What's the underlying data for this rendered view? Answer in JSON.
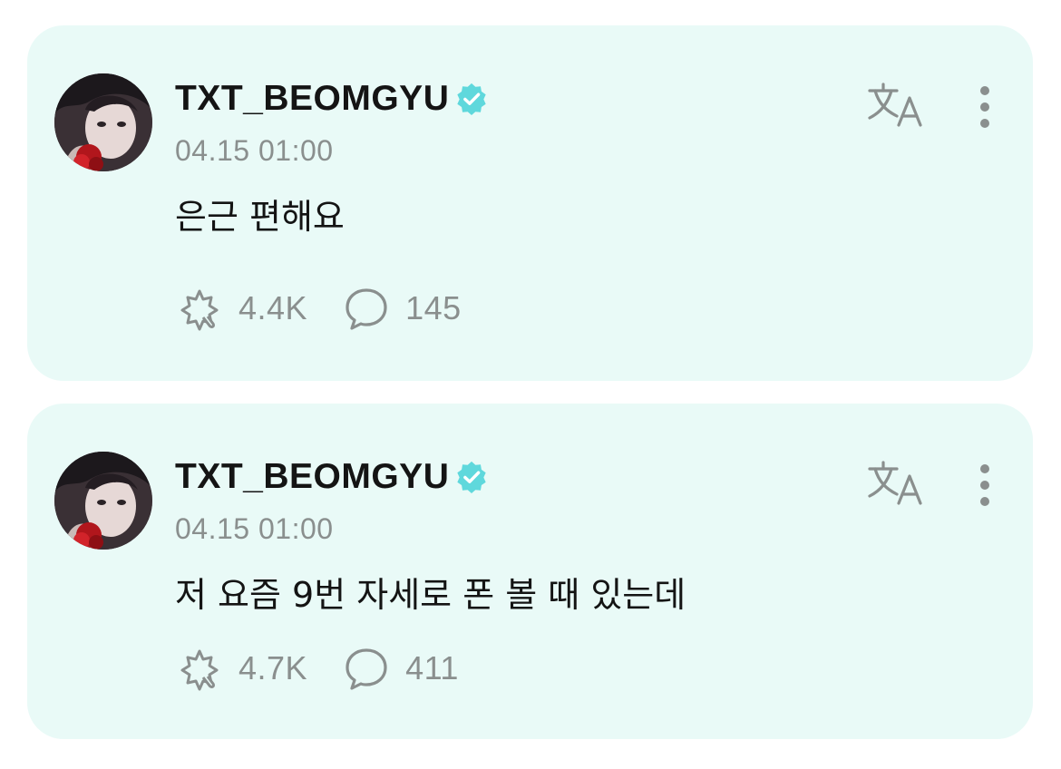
{
  "posts": [
    {
      "username": "TXT_BEOMGYU",
      "verified_icon": "verified-badge-icon",
      "timestamp": "04.15 01:00",
      "body": "은근 편해요",
      "likes": "4.4K",
      "comments": "145"
    },
    {
      "username": "TXT_BEOMGYU",
      "verified_icon": "verified-badge-icon",
      "timestamp": "04.15 01:00",
      "body": "저 요즘 9번 자세로 폰 볼 때 있는데",
      "likes": "4.7K",
      "comments": "411"
    }
  ],
  "colors": {
    "card_background": "#e9faf7",
    "verified": "#5fd8dc",
    "icon_gray": "#8a8f8e",
    "text": "#141414"
  }
}
